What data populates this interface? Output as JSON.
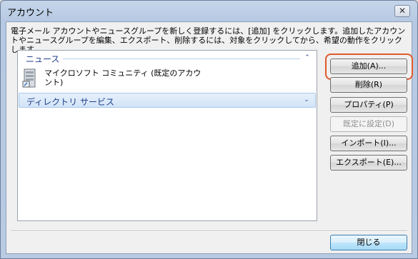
{
  "window": {
    "title": "アカウント",
    "close_glyph": "✕"
  },
  "description": "電子メール アカウントやニュースグループを新しく登録するには、[追加] をクリックします。追加したアカウントやニュースグループを編集、エクスポート、削除するには、対象をクリックしてから、希望の動作をクリックします。",
  "list": {
    "groups": [
      {
        "label": "ニュース",
        "chevron": "⌃"
      },
      {
        "label": "ディレクトリ サービス",
        "chevron": "⌄"
      }
    ],
    "accounts": [
      {
        "label": "マイクロソフト コミュニティ (既定のアカウント)",
        "icon": "server-icon"
      }
    ]
  },
  "buttons": {
    "add": "追加(A)...",
    "delete": "削除(R)",
    "properties": "プロパティ(P)",
    "set_default": "既定に設定(D)",
    "import": "インポート(I)...",
    "export": "エクスポート(E)...",
    "close": "閉じる"
  },
  "colors": {
    "highlight": "#e05a2b",
    "group_text": "#1e3e8a"
  }
}
